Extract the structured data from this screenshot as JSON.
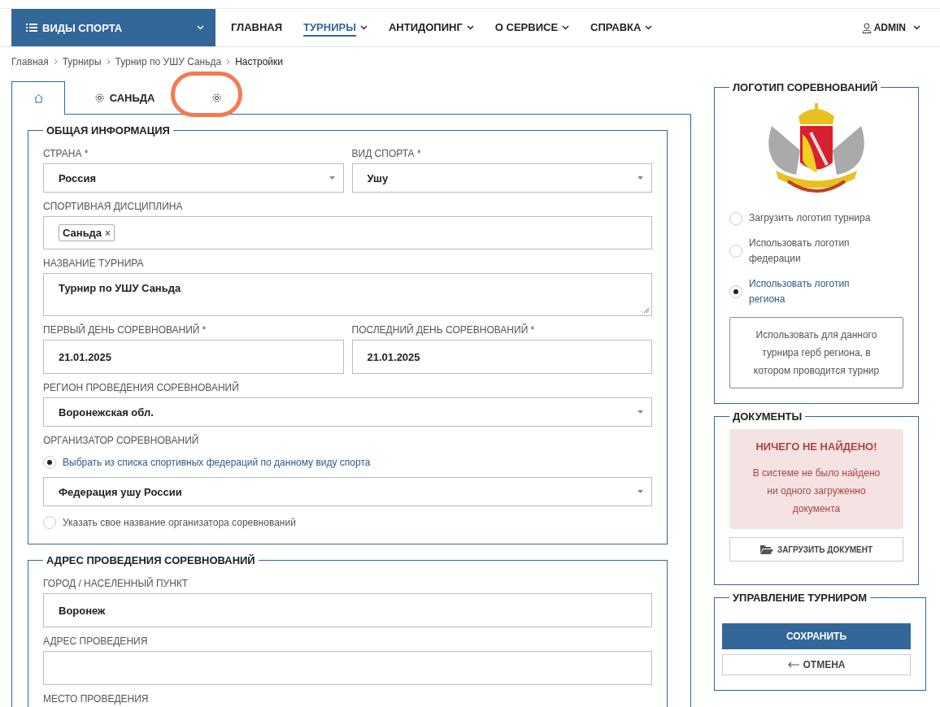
{
  "navbar": {
    "brand": "ВИДЫ СПОРТА",
    "items": [
      {
        "label": "ГЛАВНАЯ",
        "selected": false,
        "dropdown": false
      },
      {
        "label": "ТУРНИРЫ",
        "selected": true,
        "dropdown": true
      },
      {
        "label": "АНТИДОПИНГ",
        "selected": false,
        "dropdown": true
      },
      {
        "label": "О СЕРВИСЕ",
        "selected": false,
        "dropdown": true
      },
      {
        "label": "СПРАВКА",
        "selected": false,
        "dropdown": true
      }
    ],
    "user": "ADMIN"
  },
  "breadcrumb": [
    "Главная",
    "Турниры",
    "Турнир по УШУ Саньда",
    "Настройки"
  ],
  "tabs": [
    {
      "kind": "home",
      "selected": true
    },
    {
      "kind": "gear",
      "label": "САНЬДА",
      "selected": false
    },
    {
      "kind": "gear",
      "selected": false,
      "highlighted": true
    }
  ],
  "sections": [
    {
      "title": "ОБЩАЯ ИНФОРМАЦИЯ",
      "items": [
        {
          "kind": "fields",
          "fields": [
            {
              "kind": "select",
              "label": "СТРАНА *",
              "value": "Россия"
            },
            {
              "kind": "select",
              "label": "ВИД СПОРТА *",
              "value": "Ушу"
            }
          ]
        },
        {
          "kind": "fields",
          "fields": [
            {
              "kind": "tags",
              "label": "СПОРТИВНАЯ ДИСЦИПЛИНА",
              "tags": [
                {
                  "label": "Саньда",
                  "remove": "×"
                }
              ]
            }
          ]
        },
        {
          "kind": "fields",
          "fields": [
            {
              "kind": "textarea",
              "label": "НАЗВАНИЕ ТУРНИРА",
              "value": "Турнир по УШУ Саньда"
            }
          ]
        },
        {
          "kind": "fields",
          "fields": [
            {
              "kind": "text",
              "label": "ПЕРВЫЙ ДЕНЬ СОРЕВНОВАНИЙ *",
              "value": "21.01.2025"
            },
            {
              "kind": "text",
              "label": "ПОСЛЕДНИЙ ДЕНЬ СОРЕВНОВАНИЙ *",
              "value": "21.01.2025"
            }
          ]
        },
        {
          "kind": "fields",
          "fields": [
            {
              "kind": "select",
              "label": "РЕГИОН ПРОВЕДЕНИЯ СОРЕВНОВАНИЙ",
              "value": "Воронежская обл."
            }
          ]
        },
        {
          "kind": "heading",
          "text": "ОРГАНИЗАТОР СОРЕВНОВАНИЙ"
        },
        {
          "kind": "radio",
          "label": "Выбрать из списка спортивных федераций по данному виду спорта",
          "selected": true
        },
        {
          "kind": "fields",
          "fields": [
            {
              "kind": "select",
              "value": "Федерация ушу России"
            }
          ]
        },
        {
          "kind": "radio",
          "label": "Указать свое название организатора соревнований",
          "selected": false
        }
      ]
    },
    {
      "title": "АДРЕС ПРОВЕДЕНИЯ СОРЕВНОВАНИЙ",
      "items": [
        {
          "kind": "fields",
          "fields": [
            {
              "kind": "text",
              "label": "ГОРОД / НАСЕЛЕННЫЙ ПУНКТ",
              "value": "Воронеж"
            }
          ]
        },
        {
          "kind": "fields",
          "fields": [
            {
              "kind": "text",
              "label": "АДРЕС ПРОВЕДЕНИЯ"
            }
          ]
        },
        {
          "kind": "heading",
          "text": "МЕСТО ПРОВЕДЕНИЯ"
        }
      ]
    }
  ],
  "logo_panel": {
    "title": "ЛОГОТИП СОРЕВНОВАНИЙ",
    "options": [
      {
        "label": "Загрузить логотип турнира",
        "selected": false
      },
      {
        "label": "Использовать логотип федерации",
        "selected": false
      },
      {
        "label": "Использовать логотип региона",
        "selected": true
      }
    ],
    "note": "Использовать для данного турнира герб региона, в котором проводится турнир"
  },
  "documents_panel": {
    "title": "ДОКУМЕНТЫ",
    "alert_title": "НИЧЕГО НЕ НАЙДЕНО!",
    "alert_text": "В системе не было найдено ни одного загруженно документа",
    "upload_button": "ЗАГРУЗИТЬ ДОКУМЕНТ"
  },
  "management_panel": {
    "title": "УПРАВЛЕНИЕ ТУРНИРОМ",
    "save_button": "СОХРАНИТЬ",
    "cancel_button": "ОТМЕНА"
  }
}
